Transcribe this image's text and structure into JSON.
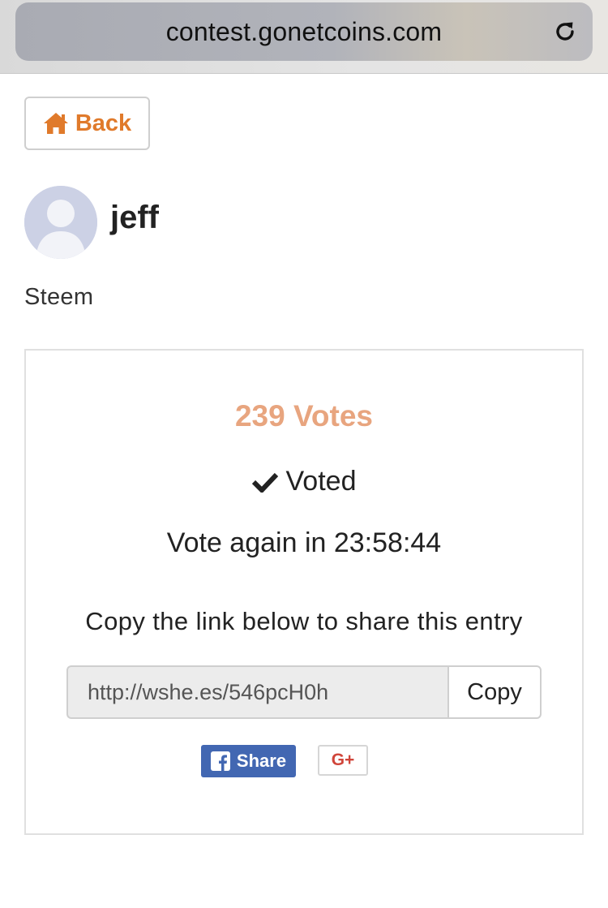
{
  "browser": {
    "url": "contest.gonetcoins.com",
    "reload_icon": "reload-icon"
  },
  "nav": {
    "back_label": "Back",
    "back_icon": "home-icon"
  },
  "entry": {
    "username": "jeff",
    "category": "Steem",
    "avatar_icon": "default-avatar-icon"
  },
  "voting": {
    "votes_label": "239 Votes",
    "voted_label": "Voted",
    "vote_again_label": "Vote again in 23:58:44"
  },
  "share": {
    "hint": "Copy the link below to share this entry",
    "link_value": "http://wshe.es/546pcH0h",
    "copy_label": "Copy",
    "facebook_label": "Share",
    "gplus_label": "G+"
  },
  "colors": {
    "accent_orange": "#e07a2b",
    "votes_color": "#e8a57f",
    "facebook_blue": "#4267b2",
    "gplus_red": "#d0453a"
  }
}
